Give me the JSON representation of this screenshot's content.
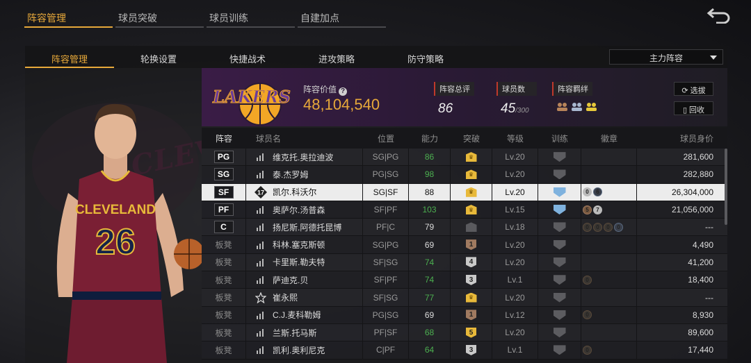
{
  "top_tabs": [
    "阵容管理",
    "球员突破",
    "球员训练",
    "自建加点"
  ],
  "sub_tabs": [
    "阵容管理",
    "轮换设置",
    "快捷战术",
    "进攻策略",
    "防守策略"
  ],
  "lineup_select": "主力阵容",
  "portrait": {
    "team_script": "CLEVELAND",
    "jersey_text": "CLEVELAND",
    "jersey_number": "26"
  },
  "header": {
    "logo_text": "LAKERS",
    "value_label": "阵容价值",
    "value": "48,104,540",
    "overall_label": "阵容总评",
    "overall": "86",
    "count_label": "球员数",
    "count": "45",
    "count_max": "/300",
    "bond_label": "阵容羁绊",
    "btn_pick": "选拔",
    "btn_recycle": "回收"
  },
  "columns": [
    "阵容",
    "球员名",
    "位置",
    "能力",
    "突破",
    "等级",
    "训练",
    "徽章",
    "球员身价"
  ],
  "rows": [
    {
      "lineup": "PG",
      "name": "维克托.奥拉迪波",
      "pos": "SG|PG",
      "ability": "86",
      "ability_color": "green",
      "breakthrough": "crown",
      "level": "Lv.20",
      "training": "grey",
      "badges": [],
      "price": "281,600"
    },
    {
      "lineup": "SG",
      "name": "泰.杰罗姆",
      "pos": "PG|SG",
      "ability": "98",
      "ability_color": "green",
      "breakthrough": "crown",
      "level": "Lv.20",
      "training": "grey",
      "badges": [],
      "price": "282,880"
    },
    {
      "lineup": "SF",
      "name": "凯尔.科沃尔",
      "pos": "SG|SF",
      "ability": "88",
      "ability_color": "dark",
      "breakthrough": "crown",
      "level": "Lv.20",
      "training": "blue",
      "badges": [
        {
          "t": "silver",
          "n": "0"
        },
        {
          "t": "dark",
          "n": "6"
        }
      ],
      "price": "26,304,000",
      "selected": true,
      "name_icon": "17"
    },
    {
      "lineup": "PF",
      "name": "奥萨尔.汤普森",
      "pos": "SF|PF",
      "ability": "103",
      "ability_color": "green",
      "breakthrough": "crown",
      "level": "Lv.15",
      "training": "blue",
      "badges": [
        {
          "t": "bronze",
          "n": "5"
        },
        {
          "t": "silver",
          "n": "7"
        }
      ],
      "price": "21,056,000"
    },
    {
      "lineup": "C",
      "name": "扬尼斯.阿德托昆博",
      "pos": "PF|C",
      "ability": "79",
      "ability_color": "plain",
      "breakthrough": "grey",
      "level": "Lv.18",
      "training": "grey",
      "badges": [
        {
          "t": "ghost",
          "n": "0"
        },
        {
          "t": "ghost",
          "n": "0"
        },
        {
          "t": "ghost",
          "n": "0"
        },
        {
          "t": "dark",
          "n": "0"
        }
      ],
      "price": "---"
    },
    {
      "lineup": "板凳",
      "name": "科林.塞克斯顿",
      "pos": "SG|PG",
      "ability": "69",
      "ability_color": "plain",
      "breakthrough": "1",
      "break_color": "bronze",
      "level": "Lv.20",
      "training": "grey",
      "badges": [],
      "price": "4,490"
    },
    {
      "lineup": "板凳",
      "name": "卡里斯.勒夫特",
      "pos": "SF|SG",
      "ability": "74",
      "ability_color": "green",
      "breakthrough": "4",
      "break_color": "silver",
      "level": "Lv.20",
      "training": "grey",
      "badges": [],
      "price": "41,200"
    },
    {
      "lineup": "板凳",
      "name": "萨迪克.贝",
      "pos": "SF|PF",
      "ability": "74",
      "ability_color": "green",
      "breakthrough": "3",
      "break_color": "silver",
      "level": "Lv.1",
      "training": "grey",
      "badges": [
        {
          "t": "ghost",
          "n": "0"
        }
      ],
      "price": "18,400"
    },
    {
      "lineup": "板凳",
      "name": "崔永熙",
      "pos": "SF|SG",
      "ability": "77",
      "ability_color": "green",
      "breakthrough": "crown",
      "level": "Lv.20",
      "training": "grey",
      "badges": [],
      "price": "---",
      "name_icon": "star"
    },
    {
      "lineup": "板凳",
      "name": "C.J.麦科勒姆",
      "pos": "PG|SG",
      "ability": "69",
      "ability_color": "plain",
      "breakthrough": "1",
      "break_color": "bronze",
      "level": "Lv.12",
      "training": "grey",
      "badges": [
        {
          "t": "ghost",
          "n": "0"
        }
      ],
      "price": "8,930"
    },
    {
      "lineup": "板凳",
      "name": "兰斯.托马斯",
      "pos": "PF|SF",
      "ability": "68",
      "ability_color": "green",
      "breakthrough": "5",
      "break_color": "gold",
      "level": "Lv.20",
      "training": "grey",
      "badges": [],
      "price": "89,600"
    },
    {
      "lineup": "板凳",
      "name": "凯利.奥利尼克",
      "pos": "C|PF",
      "ability": "64",
      "ability_color": "green",
      "breakthrough": "3",
      "break_color": "silver",
      "level": "Lv.1",
      "training": "grey",
      "badges": [
        {
          "t": "ghost",
          "n": "0"
        }
      ],
      "price": "17,440"
    }
  ],
  "colors": {
    "accent": "#e8a93a",
    "ability_green": "#4caf50",
    "lakers_purple": "#552583"
  }
}
